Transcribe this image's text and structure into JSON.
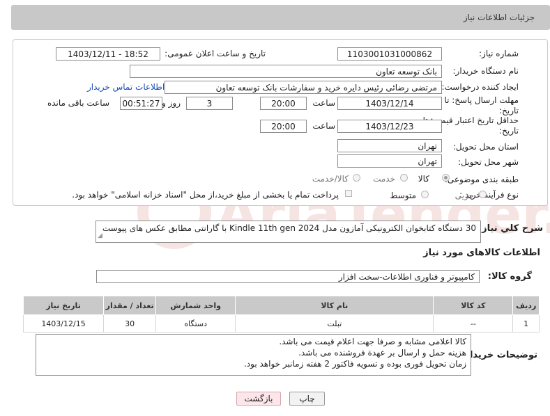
{
  "header": {
    "title": "جزئیات اطلاعات نیاز"
  },
  "form": {
    "need_number": {
      "label": "شماره نیاز:",
      "value": "1103001031000862"
    },
    "announce_datetime": {
      "label": "تاریخ و ساعت اعلان عمومی:",
      "value": "1403/12/11 - 18:52"
    },
    "buyer_org": {
      "label": "نام دستگاه خریدار:",
      "value": "بانک توسعه تعاون"
    },
    "requester": {
      "label": "ایجاد کننده درخواست:",
      "value": "مرتضی رضائی رئیس دایره خرید و سفارشات بانک توسعه تعاون",
      "contact_link": "اطلاعات تماس خریدار"
    },
    "reply_deadline": {
      "label_line1": "مهلت ارسال پاسخ: تا",
      "label_line2": "تاریخ:",
      "date": "1403/12/14",
      "time_label": "ساعت",
      "time": "20:00",
      "days": "3",
      "days_label": "روز و",
      "remaining": "00:51:27",
      "remaining_label": "ساعت باقی مانده"
    },
    "price_validity": {
      "label_line1": "حداقل تاریخ اعتبار قیمت: تا",
      "label_line2": "تاریخ:",
      "date": "1403/12/23",
      "time_label": "ساعت",
      "time": "20:00"
    },
    "delivery_province": {
      "label": "استان محل تحویل:",
      "value": "تهران"
    },
    "delivery_city": {
      "label": "شهر محل تحویل:",
      "value": "تهران"
    },
    "category": {
      "label": "طبقه بندی موضوعی:",
      "options": [
        "کالا",
        "خدمت",
        "کالا/خدمت"
      ],
      "selected": "کالا"
    },
    "purchase_type": {
      "label": "نوع فرآیند خرید :",
      "options": [
        "جزیی",
        "متوسط"
      ],
      "selected": "",
      "payment_note": "پرداخت تمام یا بخشی از مبلغ خرید،از محل \"اسناد خزانه اسلامی\" خواهد بود."
    }
  },
  "description": {
    "label": "شرح کلي نياز:",
    "value": "30 دستگاه کتابخوان الکترونیکی آمازون مدل Kindle 11th gen 2024 با گارانتی مطابق عکس های پیوست"
  },
  "goods_info_title": "اطلاعات کالاهای مورد نیاز",
  "goods_group": {
    "label": "گروه کالا:",
    "value": "کامپیوتر و فناوری اطلاعات-سخت افزار"
  },
  "table": {
    "headers": [
      "ردیف",
      "کد کالا",
      "نام کالا",
      "واحد شمارش",
      "تعداد / مقدار",
      "تاریخ نیاز"
    ],
    "rows": [
      [
        "1",
        "--",
        "تبلت",
        "دستگاه",
        "30",
        "1403/12/15"
      ]
    ]
  },
  "buyer_notes": {
    "label": "توضیحات خریدار:",
    "lines": [
      "کالا اعلامی مشابه و صرفا جهت اعلام قیمت می باشد.",
      "هزینه حمل و ارسال بر عهدة فروشنده می باشد.",
      "زمان تحویل فوری بوده و تسویه فاکتور 2 هفته زمانبر خواهد بود."
    ]
  },
  "buttons": {
    "print": "چاپ",
    "back": "بازگشت"
  },
  "colors": {
    "header_bg": "#c8c8c8",
    "link": "#1a4fb8",
    "back_button_bg": "#fde6ea",
    "watermark": "#c0392b"
  }
}
